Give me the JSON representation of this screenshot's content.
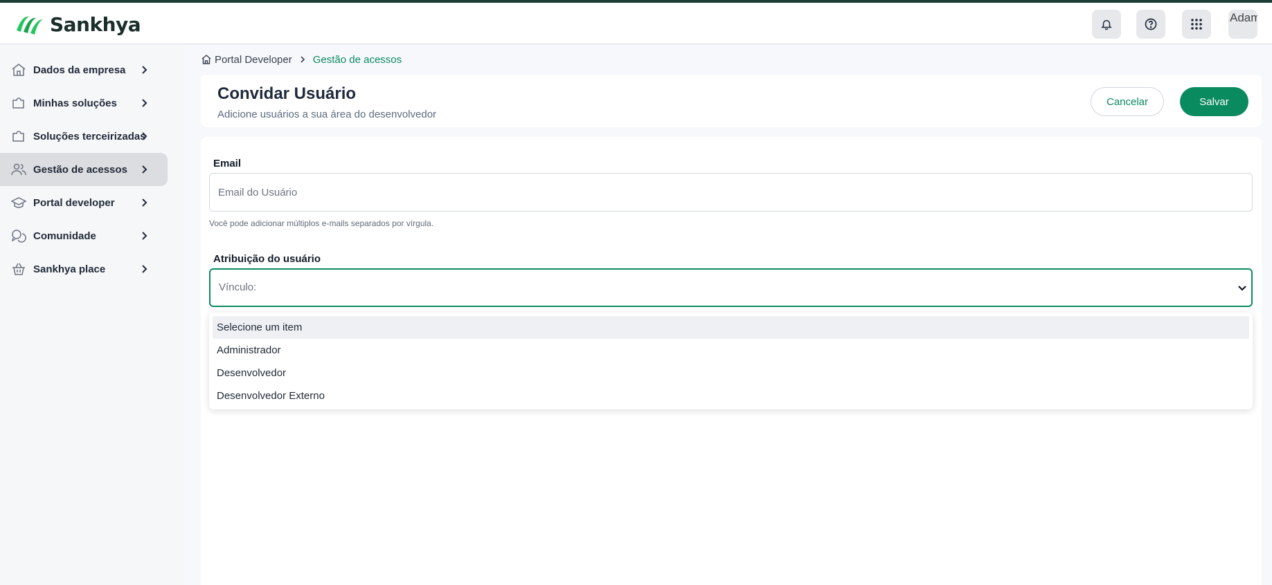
{
  "header": {
    "brand": "Sankhya",
    "avatar_alt": "Adam"
  },
  "sidebar": {
    "items": [
      {
        "label": "Dados da empresa",
        "icon": "home-icon"
      },
      {
        "label": "Minhas soluções",
        "icon": "puzzle-icon"
      },
      {
        "label": "Soluções terceirizadas",
        "icon": "puzzle-outline-icon"
      },
      {
        "label": "Gestão de acessos",
        "icon": "users-icon",
        "active": true
      },
      {
        "label": "Portal developer",
        "icon": "graduation-cap-icon"
      },
      {
        "label": "Comunidade",
        "icon": "chat-bubbles-icon"
      },
      {
        "label": "Sankhya place",
        "icon": "basket-icon"
      }
    ]
  },
  "breadcrumb": {
    "root": "Portal Developer",
    "current": "Gestão de acessos"
  },
  "page": {
    "title": "Convidar Usuário",
    "subtitle": "Adicione usuários a sua área do desenvolvedor",
    "cancel_label": "Cancelar",
    "save_label": "Salvar"
  },
  "form": {
    "email_label": "Email",
    "email_placeholder": "Email do Usuário",
    "email_hint": "Você pode adicionar múltiplos e-mails separados por vírgula.",
    "role_label": "Atribuição do usuário",
    "role_value": "Vínculo:",
    "role_options": [
      "Selecione um item",
      "Administrador",
      "Desenvolvedor",
      "Desenvolvedor Externo"
    ]
  },
  "colors": {
    "accent": "#0a8a5f",
    "brand_dark": "#1a2e2a",
    "active_nav": "#dcdde0"
  }
}
